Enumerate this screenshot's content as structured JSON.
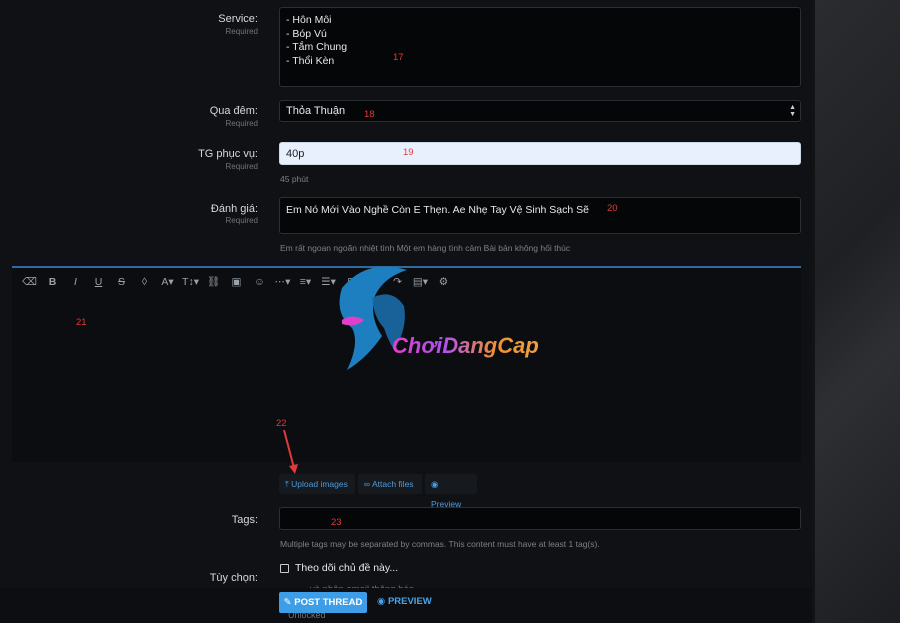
{
  "form": {
    "service": {
      "label": "Service:",
      "required": "Required",
      "lines": [
        "- Hôn Môi",
        "- Bóp Vú",
        "- Tắm Chung",
        "- Thổi Kèn"
      ],
      "marker": "17"
    },
    "qua_dem": {
      "label": "Qua đêm:",
      "required": "Required",
      "value": "Thỏa Thuận",
      "marker": "18"
    },
    "tg_phuc_vu": {
      "label": "TG phục vụ:",
      "required": "Required",
      "value": "40p",
      "hint": "45 phút",
      "marker": "19"
    },
    "danh_gia": {
      "label": "Đánh giá:",
      "required": "Required",
      "value": "Em Nó Mới Vào Nghề Còn E Thẹn. Ae Nhẹ Tay Vệ Sinh Sạch Sẽ",
      "hint": "Em rất ngoan ngoãn nhiệt tình Một em hàng tình cảm Bài bản không hối thúc",
      "marker": "20"
    },
    "editor": {
      "marker": "21",
      "toolbar_icons": [
        "eraser-icon",
        "bold-icon",
        "italic-icon",
        "underline-icon",
        "strikethrough-icon",
        "color-drop-icon",
        "font-family-icon",
        "font-size-icon",
        "link-icon",
        "image-icon",
        "smiley-icon",
        "more-icon",
        "align-icon",
        "list-icon",
        "table-icon",
        "undo-icon",
        "redo-icon",
        "drafts-icon",
        "settings-icon"
      ],
      "toolbar_glyphs": [
        "⌫",
        "B",
        "I",
        "U",
        "S",
        "◊",
        "A▾",
        "T↕▾",
        "⛓",
        "▣",
        "☺",
        "⋯▾",
        "≡▾",
        "☰▾",
        "⊞",
        "↶",
        "↷",
        "▤▾",
        "⚙"
      ]
    },
    "attachments": {
      "marker": "22",
      "upload_label": "Upload images",
      "attach_label": "Attach files",
      "preview_label": "Preview"
    },
    "tags": {
      "label": "Tags:",
      "marker": "23",
      "hint": "Multiple tags may be separated by commas. This content must have at least 1 tag(s)."
    },
    "options": {
      "label": "Tùy chọn:",
      "watch_label": "Theo dõi chủ đề này...",
      "watch_sub": "và nhận email thông báo",
      "unlocked": "Unlocked"
    },
    "actions": {
      "post_label": "POST THREAD",
      "preview_label": "PREVIEW"
    }
  },
  "watermark": {
    "brand": "ChơiDangCap"
  },
  "colors": {
    "accent": "#3d9de6",
    "marker_red": "#e03a3a",
    "panel_bg": "#0f1114"
  }
}
